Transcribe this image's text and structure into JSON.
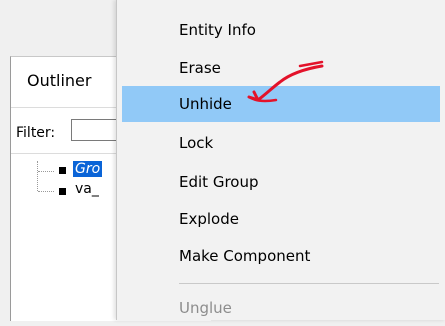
{
  "outliner": {
    "title": "Outliner",
    "filter_label": "Filter:",
    "filter_value": "",
    "items": [
      {
        "label": "Gro",
        "selected": true
      },
      {
        "label": "va_",
        "selected": false
      }
    ]
  },
  "context_menu": {
    "items": [
      {
        "label": "Entity Info",
        "highlighted": false,
        "enabled": true
      },
      {
        "label": "Erase",
        "highlighted": false,
        "enabled": true
      },
      {
        "label": "Unhide",
        "highlighted": true,
        "enabled": true
      },
      {
        "label": "Lock",
        "highlighted": false,
        "enabled": true
      },
      {
        "label": "Edit Group",
        "highlighted": false,
        "enabled": true
      },
      {
        "label": "Explode",
        "highlighted": false,
        "enabled": true
      },
      {
        "label": "Make Component",
        "highlighted": false,
        "enabled": true
      },
      {
        "label": "Unglue",
        "highlighted": false,
        "enabled": false
      }
    ]
  },
  "colors": {
    "highlight": "#91c9f7",
    "selection": "#0a64d7",
    "annotation_arrow": "#e3122a"
  }
}
